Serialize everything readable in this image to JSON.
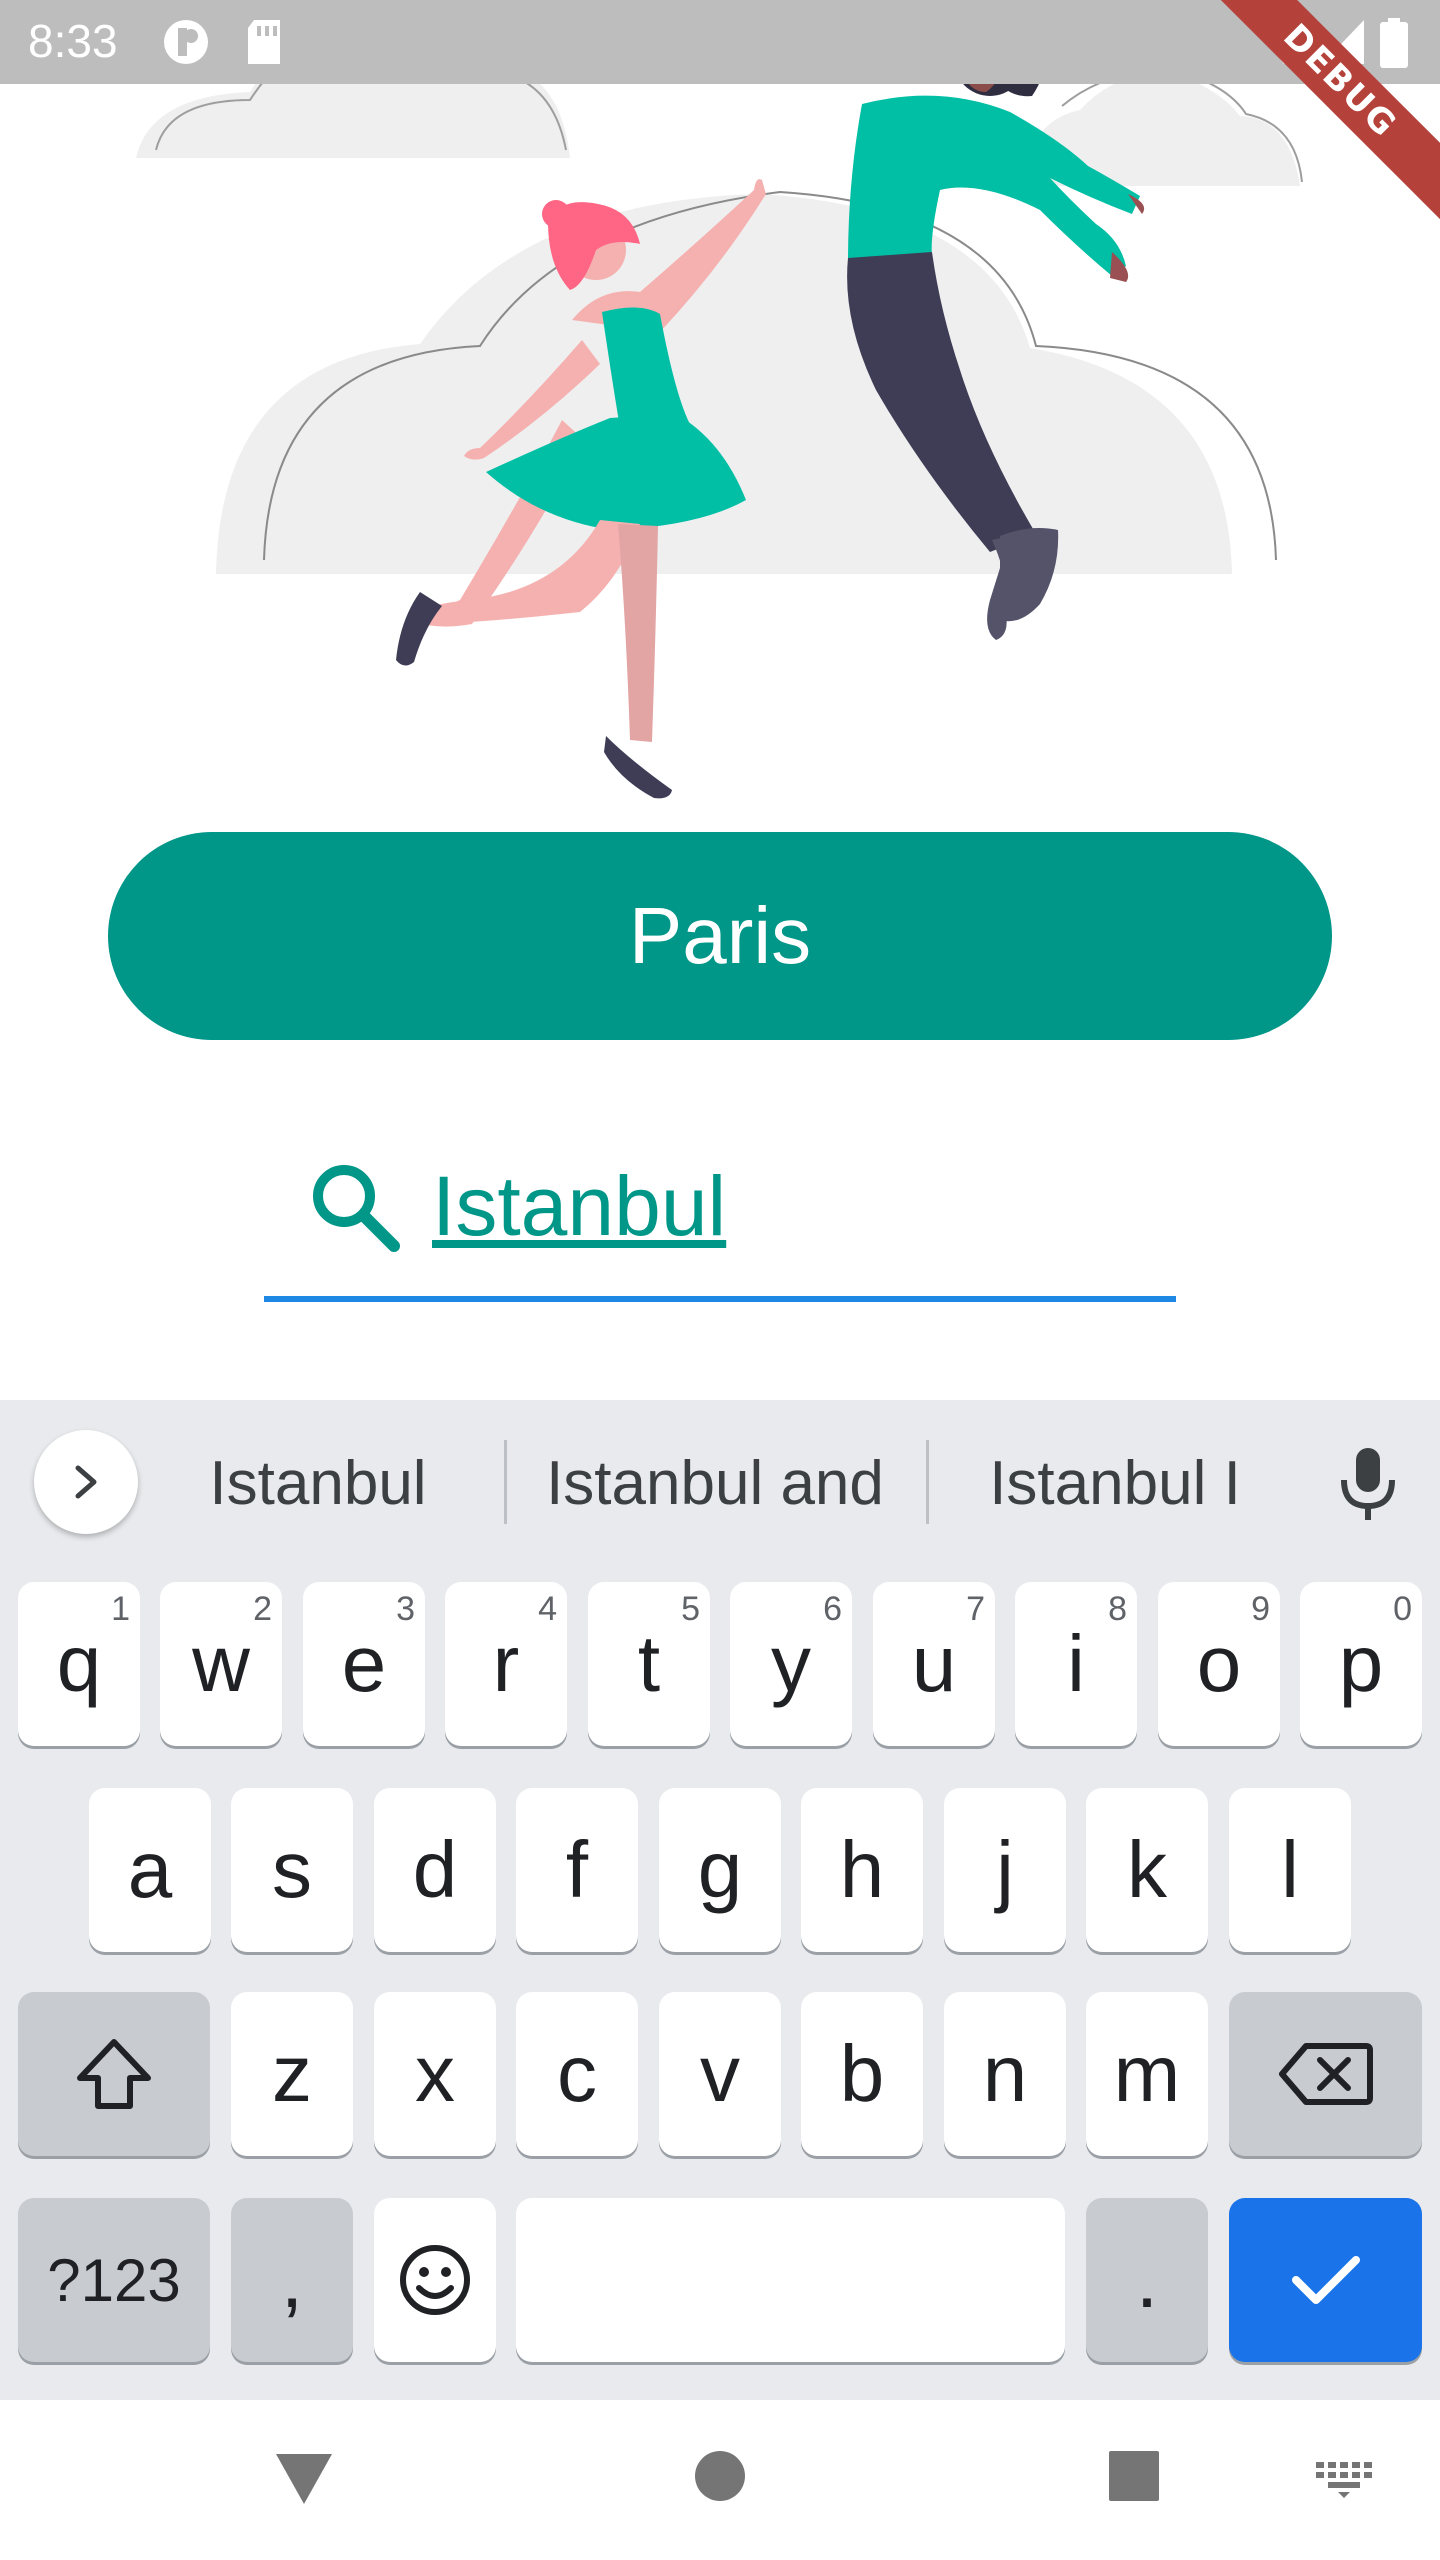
{
  "status_bar": {
    "time": "8:33"
  },
  "debug_banner": "DEBUG",
  "city_button": {
    "label": "Paris",
    "color": "#009688"
  },
  "search": {
    "value": "Istanbul",
    "underline_color": "#1e88e5"
  },
  "keyboard": {
    "suggestions": [
      "Istanbul",
      "Istanbul and",
      "Istanbul I"
    ],
    "row1": [
      {
        "k": "q",
        "h": "1"
      },
      {
        "k": "w",
        "h": "2"
      },
      {
        "k": "e",
        "h": "3"
      },
      {
        "k": "r",
        "h": "4"
      },
      {
        "k": "t",
        "h": "5"
      },
      {
        "k": "y",
        "h": "6"
      },
      {
        "k": "u",
        "h": "7"
      },
      {
        "k": "i",
        "h": "8"
      },
      {
        "k": "o",
        "h": "9"
      },
      {
        "k": "p",
        "h": "0"
      }
    ],
    "row2": [
      "a",
      "s",
      "d",
      "f",
      "g",
      "h",
      "j",
      "k",
      "l"
    ],
    "row3": [
      "z",
      "x",
      "c",
      "v",
      "b",
      "n",
      "m"
    ],
    "symbols_label": "?123",
    "comma": ",",
    "period": ".",
    "done_color": "#1a73e8"
  }
}
